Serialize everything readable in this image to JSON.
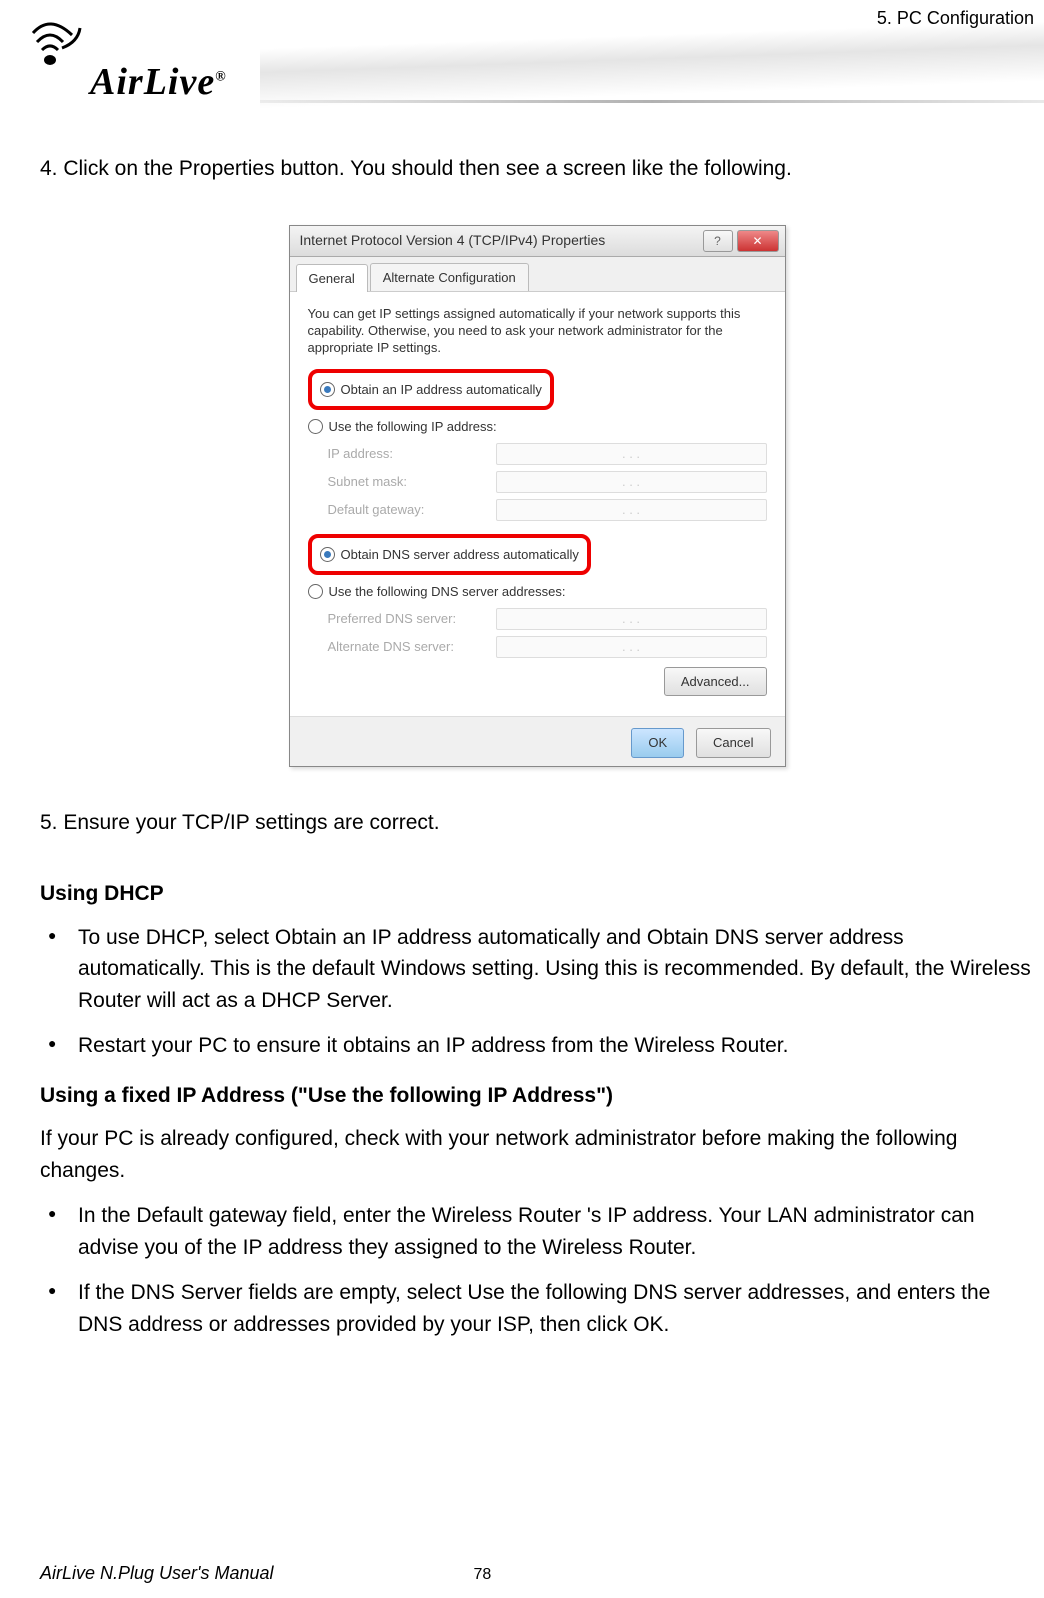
{
  "header": {
    "chapter": "5. PC Configuration",
    "brand": "AirLive",
    "brand_r": "®"
  },
  "steps": {
    "step4": "4. Click on the Properties button. You should then see a screen like the following.",
    "step5": "5.   Ensure your TCP/IP settings are correct."
  },
  "dialog": {
    "title": "Internet Protocol Version 4 (TCP/IPv4) Properties",
    "help_btn": "?",
    "close_btn": "✕",
    "tabs": {
      "general": "General",
      "alternate": "Alternate Configuration"
    },
    "description": "You can get IP settings assigned automatically if your network supports this capability. Otherwise, you need to ask your network administrator for the appropriate IP settings.",
    "radio_obtain_ip": "Obtain an IP address automatically",
    "radio_use_ip": "Use the following IP address:",
    "label_ip": "IP address:",
    "label_subnet": "Subnet mask:",
    "label_gateway": "Default gateway:",
    "radio_obtain_dns": "Obtain DNS server address automatically",
    "radio_use_dns": "Use the following DNS server addresses:",
    "label_pref_dns": "Preferred DNS server:",
    "label_alt_dns": "Alternate DNS server:",
    "ip_placeholder": ".       .       .",
    "btn_advanced": "Advanced...",
    "btn_ok": "OK",
    "btn_cancel": "Cancel"
  },
  "sections": {
    "dhcp_heading": "Using DHCP",
    "dhcp_bullets": [
      "To use DHCP, select Obtain an IP address automatically and Obtain DNS server address automatically. This is the default Windows setting. Using this is recommended. By default, the Wireless Router will act as a DHCP Server.",
      "Restart your PC to ensure it obtains an IP address from the Wireless Router."
    ],
    "fixed_heading": "Using a fixed IP Address (\"Use the following IP Address\")",
    "fixed_para": "If your PC is already configured, check with your network administrator before making the following changes.",
    "fixed_bullets": [
      "In the Default gateway field, enter the Wireless Router 's IP address. Your LAN administrator can advise you of the IP address they assigned to the Wireless Router.",
      "If the DNS Server fields are empty, select Use the following DNS server addresses, and enters the DNS address or addresses provided by your ISP, then click OK."
    ]
  },
  "footer": {
    "manual": "AirLive N.Plug User's Manual",
    "page": "78"
  }
}
